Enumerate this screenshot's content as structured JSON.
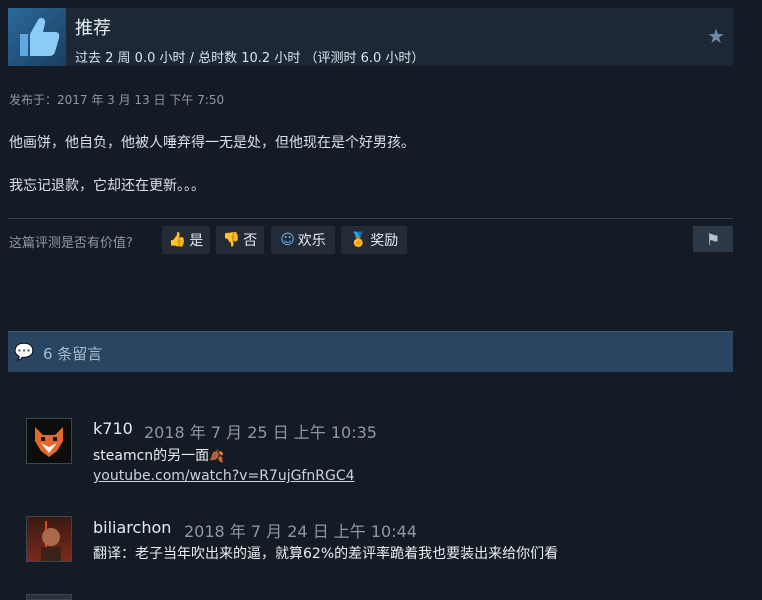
{
  "review": {
    "title": "推荐",
    "hours": "过去 2 周 0.0 小时 / 总时数 10.2 小时 （评测时 6.0 小时）",
    "posted": "发布于：2017 年 3 月 13 日 下午 7:50",
    "paragraphs": [
      "他画饼，他自负，他被人唾弃得一无是处，但他现在是个好男孩。",
      "我忘记退款，它却还在更新。。。"
    ]
  },
  "helpful": {
    "prompt": "这篇评测是否有价值?",
    "yes": "是",
    "no": "否",
    "funny": "欢乐",
    "award": "奖励"
  },
  "comments": {
    "count_label": "6 条留言",
    "items": [
      {
        "author": "k710",
        "time": "2018 年 7 月 25 日 上午 10:35",
        "text": "steamcn的另一面",
        "link": "youtube.com/watch?v=R7ujGfnRGC4"
      },
      {
        "author": "biliarchon",
        "time": "2018 年 7 月 24 日 上午 10:44",
        "text": "翻译：老子当年吹出来的逼，就算62%的差评率跪着我也要装出来给你们看"
      }
    ]
  }
}
